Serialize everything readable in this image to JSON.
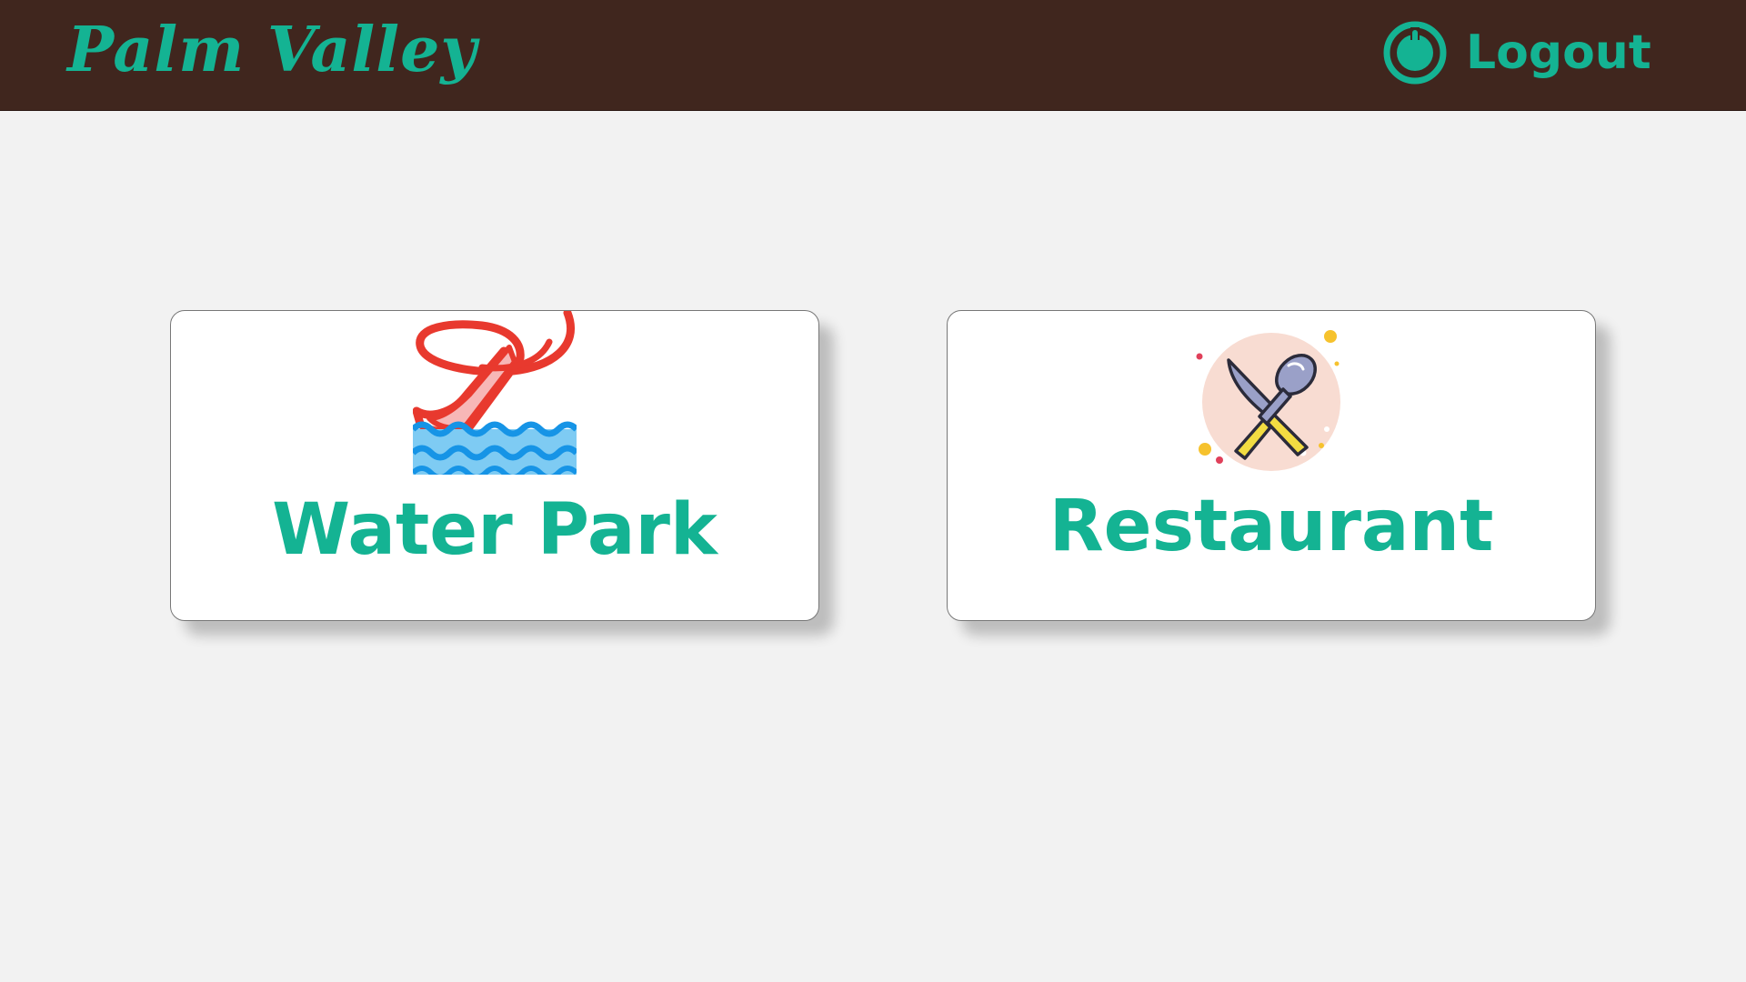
{
  "header": {
    "brand": "Palm Valley",
    "logout_label": "Logout",
    "logout_icon": "power-icon"
  },
  "cards": [
    {
      "label": "Water Park",
      "icon": "water-slide-icon"
    },
    {
      "label": "Restaurant",
      "icon": "knife-spoon-icon"
    }
  ],
  "colors": {
    "header_bg": "#40261e",
    "accent": "#14b393",
    "page_bg": "#f2f2f2",
    "card_bg": "#ffffff"
  }
}
